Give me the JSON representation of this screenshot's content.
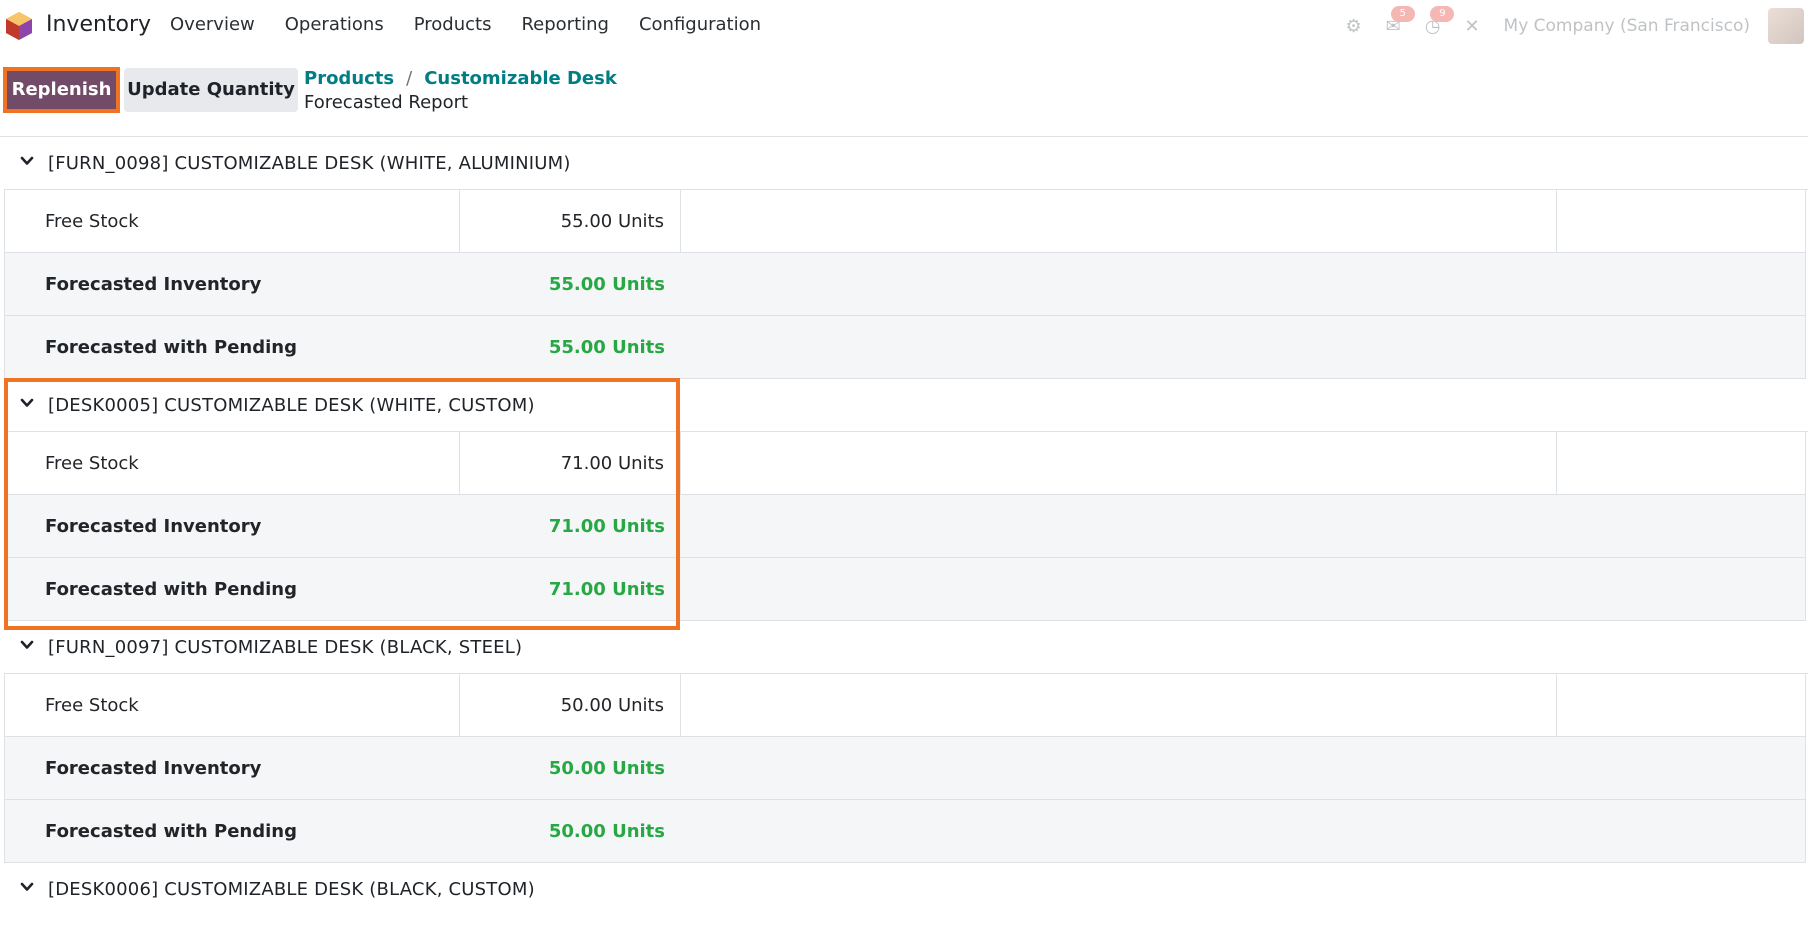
{
  "app": {
    "name": "Inventory",
    "brand_color": "#714b67"
  },
  "nav": {
    "items": [
      {
        "label": "Overview"
      },
      {
        "label": "Operations"
      },
      {
        "label": "Products"
      },
      {
        "label": "Reporting"
      },
      {
        "label": "Configuration"
      }
    ]
  },
  "systray": {
    "chat_badge": "5",
    "activity_badge": "9",
    "company": "My Company (San Francisco)"
  },
  "control_panel": {
    "replenish_label": "Replenish",
    "update_quantity_label": "Update Quantity",
    "breadcrumb": {
      "root": "Products",
      "separator": "/",
      "parent": "Customizable Desk",
      "current": "Forecasted Report"
    }
  },
  "report": {
    "groups": [
      {
        "title": "[FURN_0098] CUSTOMIZABLE DESK (WHITE, ALUMINIUM)",
        "rows": [
          {
            "label": "Free Stock",
            "value": "55.00 Units"
          },
          {
            "label": "Forecasted Inventory",
            "value": "55.00 Units"
          },
          {
            "label": "Forecasted with Pending",
            "value": "55.00 Units"
          }
        ]
      },
      {
        "title": "[DESK0005] CUSTOMIZABLE DESK (WHITE, CUSTOM)",
        "rows": [
          {
            "label": "Free Stock",
            "value": "71.00 Units"
          },
          {
            "label": "Forecasted Inventory",
            "value": "71.00 Units"
          },
          {
            "label": "Forecasted with Pending",
            "value": "71.00 Units"
          }
        ]
      },
      {
        "title": "[FURN_0097] CUSTOMIZABLE DESK (BLACK, STEEL)",
        "rows": [
          {
            "label": "Free Stock",
            "value": "50.00 Units"
          },
          {
            "label": "Forecasted Inventory",
            "value": "50.00 Units"
          },
          {
            "label": "Forecasted with Pending",
            "value": "50.00 Units"
          }
        ]
      },
      {
        "title": "[DESK0006] CUSTOMIZABLE DESK (BLACK, CUSTOM)",
        "rows": []
      }
    ]
  },
  "colors": {
    "highlight": "#f07324",
    "link": "#017e84",
    "positive": "#28a745"
  }
}
